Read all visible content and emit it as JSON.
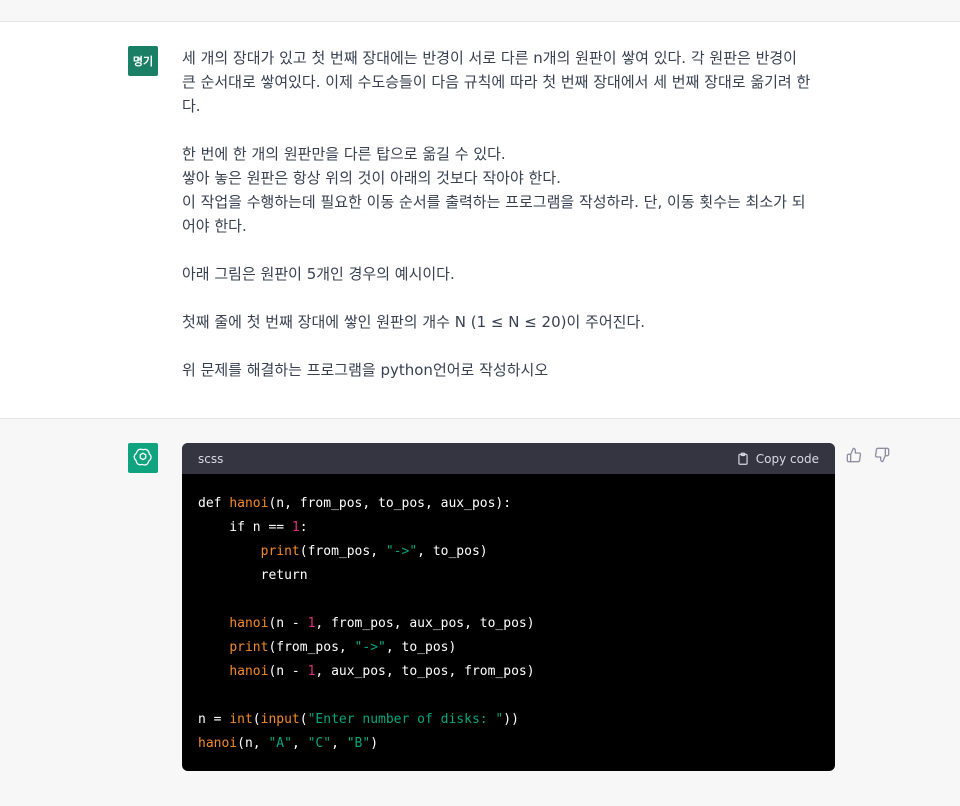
{
  "user": {
    "avatar_label": "명기",
    "paragraphs": [
      [
        "세 개의 장대가 있고 첫 번째 장대에는 반경이 서로 다른 n개의 원판이 쌓여 있다. 각 원판은 반경이",
        "큰 순서대로 쌓여있다. 이제 수도승들이 다음 규칙에 따라 첫 번째 장대에서 세 번째 장대로 옮기려 한",
        "다."
      ],
      [
        "한 번에 한 개의 원판만을 다른 탑으로 옮길 수 있다.",
        "쌓아 놓은 원판은 항상 위의 것이 아래의 것보다 작아야 한다.",
        "이 작업을 수행하는데 필요한 이동 순서를 출력하는 프로그램을 작성하라. 단, 이동 횟수는 최소가 되",
        "어야 한다."
      ],
      [
        "아래 그림은 원판이 5개인 경우의 예시이다."
      ],
      [
        "첫째 줄에 첫 번째 장대에 쌓인 원판의 개수 N (1 ≤ N ≤ 20)이 주어진다."
      ],
      [
        "위 문제를 해결하는 프로그램을 python언어로 작성하시오"
      ]
    ]
  },
  "assistant": {
    "avatar_icon": "openai-logo-icon",
    "code": {
      "language": "scss",
      "copy_label": "Copy code",
      "lines": [
        "def hanoi(n, from_pos, to_pos, aux_pos):",
        "    if n == 1:",
        "        print(from_pos, \"->\", to_pos)",
        "        return",
        "",
        "    hanoi(n - 1, from_pos, aux_pos, to_pos)",
        "    print(from_pos, \"->\", to_pos)",
        "    hanoi(n - 1, aux_pos, to_pos, from_pos)",
        "",
        "n = int(input(\"Enter number of disks: \"))",
        "hanoi(n, \"A\", \"C\", \"B\")"
      ]
    },
    "feedback": {
      "thumbs_up_icon": "thumbs-up-icon",
      "thumbs_down_icon": "thumbs-down-icon"
    }
  },
  "colors": {
    "user_avatar": "#1a7f64",
    "gpt_avatar": "#10a37f",
    "code_bg": "#000000",
    "code_header_bg": "#343541",
    "function": "#f28b2b",
    "number": "#df3079",
    "string": "#00a67d"
  }
}
